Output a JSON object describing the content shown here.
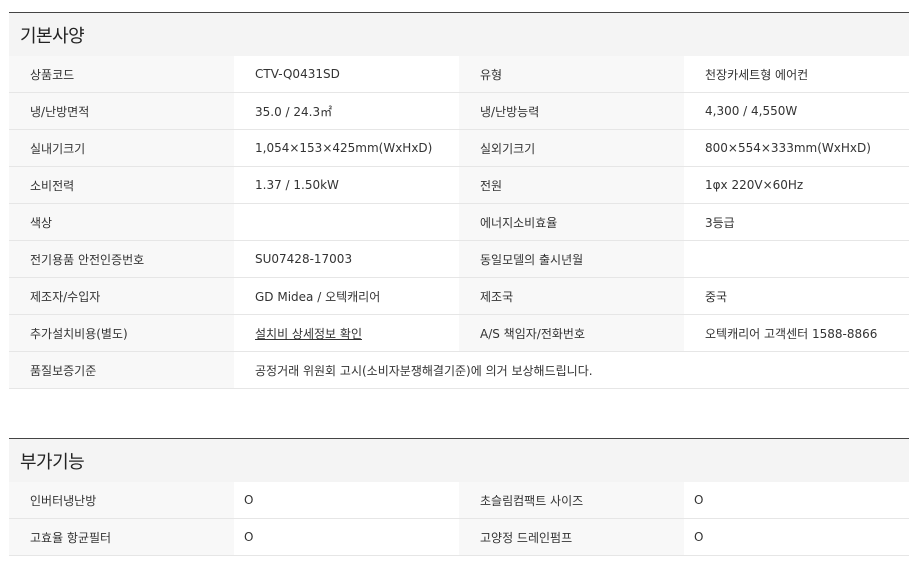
{
  "basic": {
    "title": "기본사양",
    "rows": [
      {
        "k1": "상품코드",
        "v1": "CTV-Q0431SD",
        "k2": "유형",
        "v2": "천장카세트형 에어컨"
      },
      {
        "k1": "냉/난방면적",
        "v1": "35.0 / 24.3㎡",
        "k2": "냉/난방능력",
        "v2": "4,300 / 4,550W"
      },
      {
        "k1": "실내기크기",
        "v1": "1,054×153×425mm(WxHxD)",
        "k2": "실외기크기",
        "v2": "800×554×333mm(WxHxD)"
      },
      {
        "k1": "소비전력",
        "v1": "1.37 / 1.50kW",
        "k2": "전원",
        "v2": "1φx 220V×60Hz"
      },
      {
        "k1": "색상",
        "v1": "",
        "k2": "에너지소비효율",
        "v2": "3등급"
      },
      {
        "k1": "전기용품 안전인증번호",
        "v1": "SU07428-17003",
        "k2": "동일모델의 출시년월",
        "v2": ""
      },
      {
        "k1": "제조자/수입자",
        "v1": "GD Midea / 오텍캐리어",
        "k2": "제조국",
        "v2": "중국"
      },
      {
        "k1": "추가설치비용(별도)",
        "v1": "설치비 상세정보 확인",
        "k2": "A/S 책임자/전화번호",
        "v2": "오텍캐리어 고객센터 1588-8866"
      }
    ],
    "warranty": {
      "k": "품질보증기준",
      "v": "공정거래 위원회 고시(소비자분쟁해결기준)에 의거 보상해드립니다."
    }
  },
  "extra": {
    "title": "부가기능",
    "rows": [
      {
        "k1": "인버터냉난방",
        "v1": "O",
        "k2": "초슬림컴팩트 사이즈",
        "v2": "O"
      },
      {
        "k1": "고효율 항균필터",
        "v1": "O",
        "k2": "고양정 드레인펌프",
        "v2": "O"
      }
    ]
  }
}
